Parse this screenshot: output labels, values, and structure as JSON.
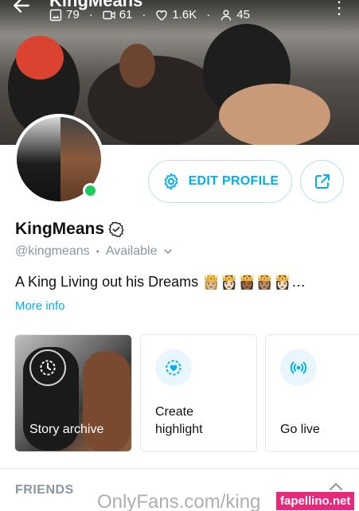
{
  "header": {
    "title": "KingMeans",
    "stats": [
      {
        "icon": "image-icon",
        "value": "79"
      },
      {
        "icon": "video-icon",
        "value": "61"
      },
      {
        "icon": "heart-icon",
        "value": "1.6K"
      },
      {
        "icon": "fans-icon",
        "value": "45"
      }
    ]
  },
  "profile": {
    "name": "KingMeans",
    "handle": "@kingmeans",
    "separator": "•",
    "status": "Available",
    "bio": "A King Living out his Dreams 👸🏼👸🏻👸🏾👸🏽👸🏻…",
    "more_info": "More info"
  },
  "actions": {
    "edit_profile": "EDIT PROFILE"
  },
  "cards": [
    {
      "label": "Story archive"
    },
    {
      "label_line1": "Create",
      "label_line2": "highlight"
    },
    {
      "label": "Go live"
    }
  ],
  "sections": {
    "friends": "FRIENDS"
  },
  "watermark": {
    "text": "OnlyFans.com/king",
    "badge": "fapellino.net"
  },
  "colors": {
    "accent": "#00aff0",
    "online": "#1ec95e",
    "muted": "#8a96a3"
  }
}
